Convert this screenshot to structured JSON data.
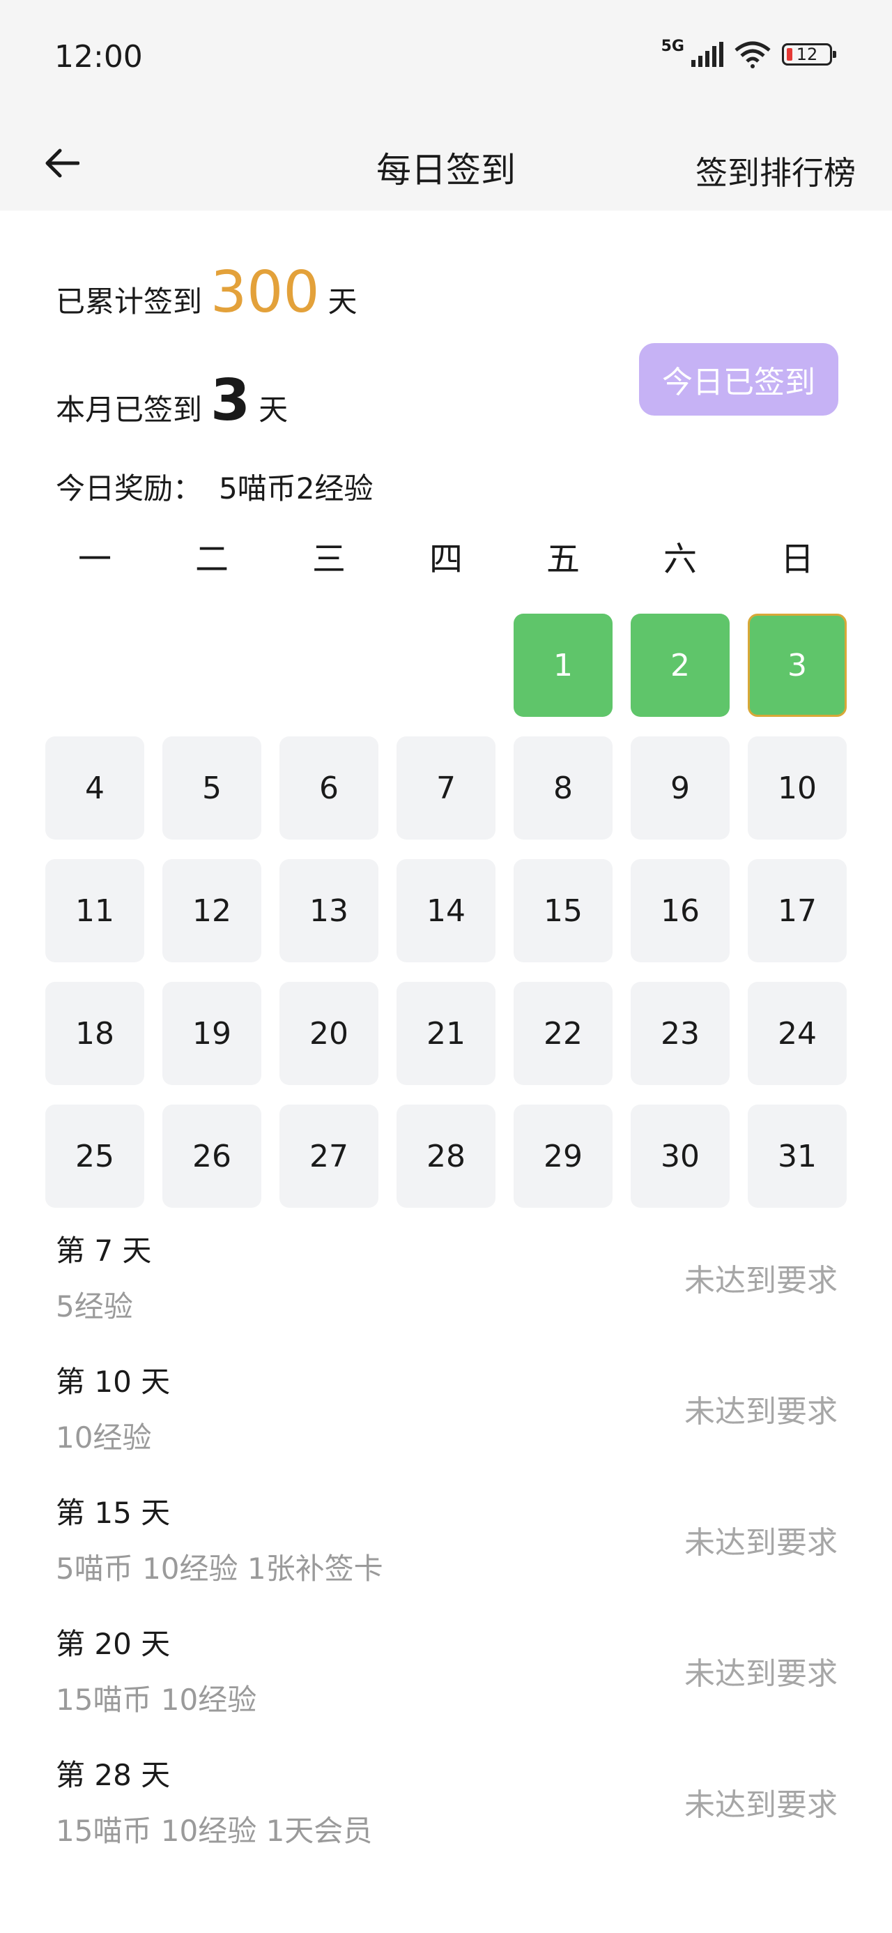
{
  "status_bar": {
    "time": "12:00",
    "network": "5G",
    "battery": "12",
    "icons": [
      "signal-icon",
      "wifi-icon",
      "battery-icon"
    ]
  },
  "nav": {
    "title": "每日签到",
    "right_link": "签到排行榜"
  },
  "summary": {
    "total_prefix": "已累计签到",
    "total_value": "300",
    "total_suffix": "天",
    "month_prefix": "本月已签到",
    "month_value": "3",
    "month_suffix": "天",
    "reward_label": "今日奖励：",
    "reward_value": "5喵币2经验",
    "signed_button": "今日已签到"
  },
  "colors": {
    "accent_orange": "#e3a13a",
    "signed_green": "#5fc56a",
    "button_purple": "#c6b2f5",
    "cell_gray": "#f2f3f5",
    "muted_text": "#9a9a9a"
  },
  "weekdays": [
    "一",
    "二",
    "三",
    "四",
    "五",
    "六",
    "日"
  ],
  "calendar": {
    "first_weekday_index": 4,
    "days": [
      "1",
      "2",
      "3",
      "4",
      "5",
      "6",
      "7",
      "8",
      "9",
      "10",
      "11",
      "12",
      "13",
      "14",
      "15",
      "16",
      "17",
      "18",
      "19",
      "20",
      "21",
      "22",
      "23",
      "24",
      "25",
      "26",
      "27",
      "28",
      "29",
      "30",
      "31"
    ],
    "signed_days": [
      "1",
      "2",
      "3"
    ],
    "today": "3"
  },
  "milestones": [
    {
      "title": "第 7 天",
      "reward": "5经验",
      "status": "未达到要求"
    },
    {
      "title": "第 10 天",
      "reward": "10经验",
      "status": "未达到要求"
    },
    {
      "title": "第 15 天",
      "reward": "5喵币 10经验 1张补签卡",
      "status": "未达到要求"
    },
    {
      "title": "第 20 天",
      "reward": "15喵币 10经验",
      "status": "未达到要求"
    },
    {
      "title": "第 28 天",
      "reward": "15喵币 10经验 1天会员",
      "status": "未达到要求"
    }
  ]
}
